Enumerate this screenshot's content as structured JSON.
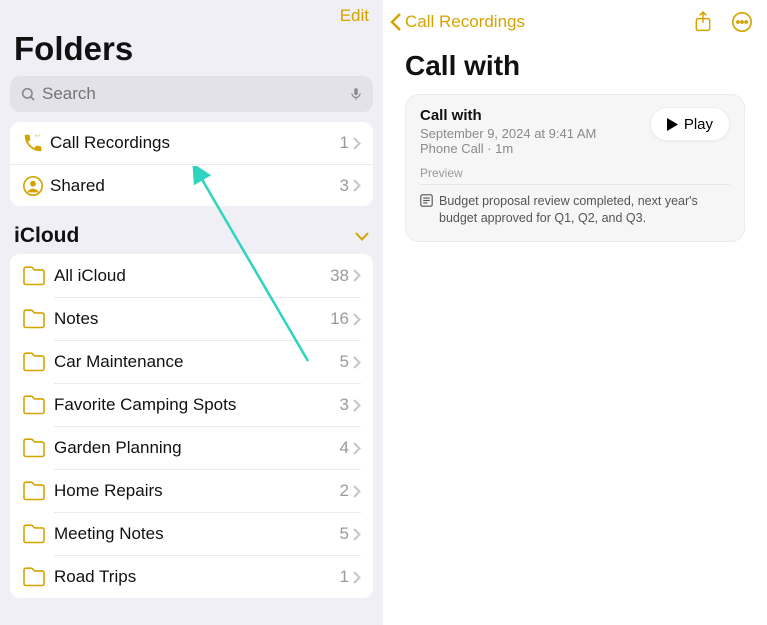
{
  "left": {
    "edit": "Edit",
    "title": "Folders",
    "search_placeholder": "Search",
    "top_rows": [
      {
        "key": "call-recordings",
        "label": "Call Recordings",
        "count": "1",
        "icon": "phone"
      },
      {
        "key": "shared",
        "label": "Shared",
        "count": "3",
        "icon": "person"
      }
    ],
    "section": {
      "title": "iCloud",
      "folders": [
        {
          "label": "All iCloud",
          "count": "38"
        },
        {
          "label": "Notes",
          "count": "16"
        },
        {
          "label": "Car Maintenance",
          "count": "5"
        },
        {
          "label": "Favorite Camping Spots",
          "count": "3"
        },
        {
          "label": "Garden Planning",
          "count": "4"
        },
        {
          "label": "Home Repairs",
          "count": "2"
        },
        {
          "label": "Meeting Notes",
          "count": "5"
        },
        {
          "label": "Road Trips",
          "count": "1"
        }
      ]
    }
  },
  "right": {
    "back": "Call Recordings",
    "title": "Call with",
    "card": {
      "title": "Call with",
      "date": "September 9, 2024 at 9:41 AM",
      "meta": "Phone Call · 1m",
      "play": "Play",
      "preview_label": "Preview",
      "summary": "Budget proposal review completed, next year's budget approved for Q1, Q2, and Q3."
    }
  }
}
